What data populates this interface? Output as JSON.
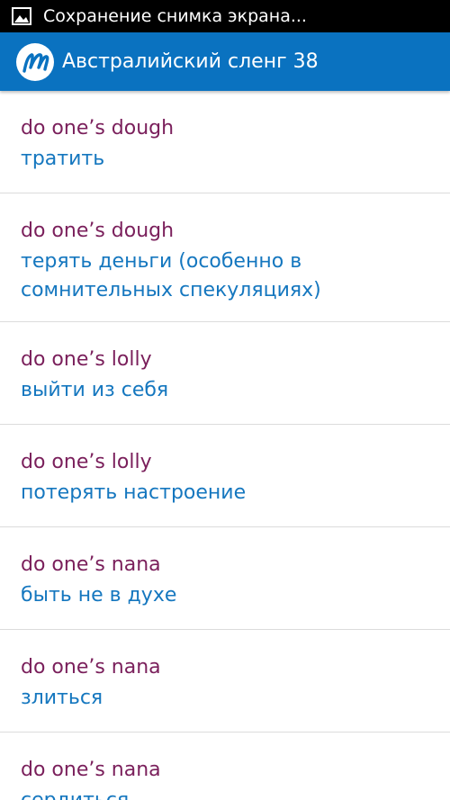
{
  "status_bar": {
    "notification_icon": "image-icon",
    "text": "Сохранение снимка экрана..."
  },
  "action_bar": {
    "logo_icon": "app-logo-m-icon",
    "title": "Австралийский сленг 38",
    "background": "#0a72c0"
  },
  "colors": {
    "term": "#7a1f5b",
    "translation": "#1577bf",
    "divider": "#dcdcdc"
  },
  "list": {
    "items": [
      {
        "term": "do one’s dough",
        "translation": "тратить"
      },
      {
        "term": "do one’s dough",
        "translation": "терять деньги (особенно в сомнительных спекуляциях)"
      },
      {
        "term": "do one’s lolly",
        "translation": "выйти из себя"
      },
      {
        "term": "do one’s lolly",
        "translation": "потерять настроение"
      },
      {
        "term": "do one’s nana",
        "translation": "быть не в духе"
      },
      {
        "term": "do one’s nana",
        "translation": "злиться"
      },
      {
        "term": "do one’s nana",
        "translation": "сердиться"
      }
    ]
  }
}
